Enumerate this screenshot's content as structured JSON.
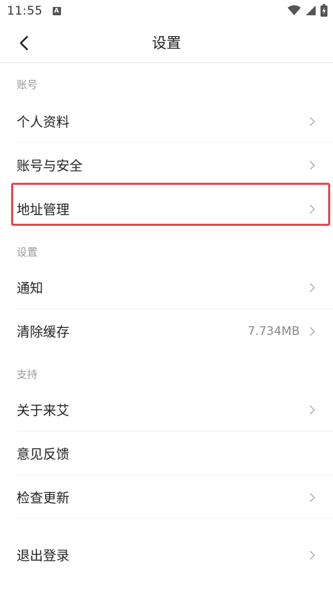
{
  "status_bar": {
    "time": "11:55",
    "badge": "A"
  },
  "nav": {
    "title": "设置"
  },
  "sections": {
    "account": {
      "header": "账号",
      "items": [
        {
          "label": "个人资料"
        },
        {
          "label": "账号与安全"
        },
        {
          "label": "地址管理"
        }
      ]
    },
    "settings": {
      "header": "设置",
      "items": [
        {
          "label": "通知"
        },
        {
          "label": "清除缓存",
          "value": "7.734MB"
        }
      ]
    },
    "support": {
      "header": "支持",
      "items": [
        {
          "label": "关于来艾"
        },
        {
          "label": "意见反馈"
        },
        {
          "label": "检查更新"
        }
      ]
    },
    "logout": {
      "label": "退出登录"
    }
  },
  "colors": {
    "highlight": "#e5484d",
    "section_header": "#999999",
    "divider": "#efefef"
  }
}
